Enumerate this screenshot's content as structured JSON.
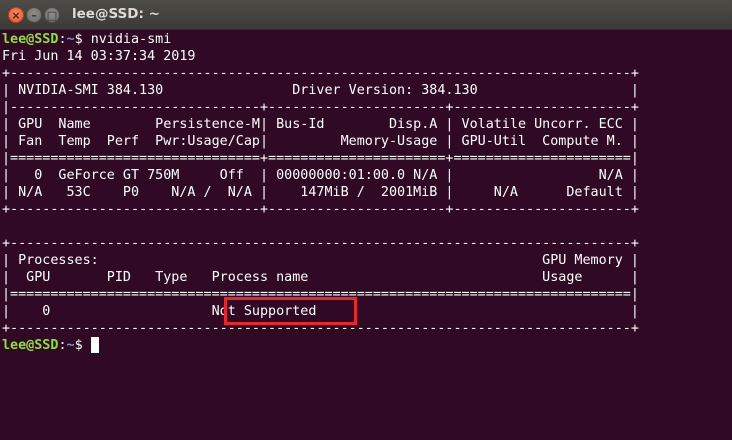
{
  "window": {
    "title": "lee@SSD: ~",
    "close_glyph": "×",
    "minimize_glyph": "–",
    "maximize_glyph": "□"
  },
  "colors": {
    "background": "#300a24",
    "prompt_user": "#8ae234",
    "prompt_path": "#729fcf",
    "highlight": "#e8262c"
  },
  "prompt": {
    "user_host": "lee@SSD",
    "separator": ":",
    "path": "~",
    "symbol": "$ "
  },
  "command": "nvidia-smi",
  "output": [
    "Fri Jun 14 03:37:34 2019",
    "+-----------------------------------------------------------------------------+",
    "| NVIDIA-SMI 384.130                Driver Version: 384.130                   |",
    "|-------------------------------+----------------------+----------------------+",
    "| GPU  Name        Persistence-M| Bus-Id        Disp.A | Volatile Uncorr. ECC |",
    "| Fan  Temp  Perf  Pwr:Usage/Cap|         Memory-Usage | GPU-Util  Compute M. |",
    "|===============================+======================+======================|",
    "|   0  GeForce GT 750M     Off  | 00000000:01:00.0 N/A |                  N/A |",
    "| N/A   53C    P0    N/A /  N/A |    147MiB /  2001MiB |     N/A      Default |",
    "+-------------------------------+----------------------+----------------------+",
    "",
    "+-----------------------------------------------------------------------------+",
    "| Processes:                                                       GPU Memory |",
    "|  GPU       PID   Type   Process name                             Usage      |",
    "|=============================================================================|",
    "|    0                    Not Supported                                       |",
    "+-----------------------------------------------------------------------------+"
  ]
}
